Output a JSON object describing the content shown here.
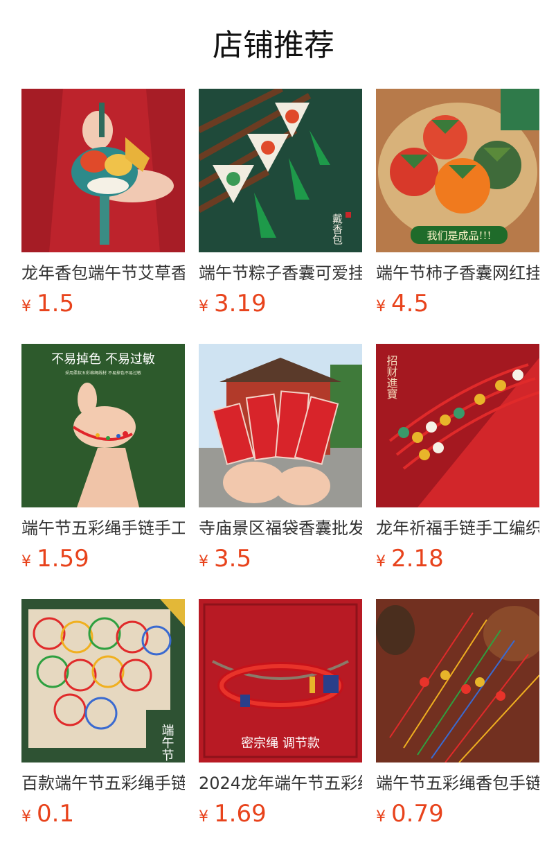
{
  "page": {
    "title": "店铺推荐"
  },
  "products": [
    {
      "name": "龙年香包端午节艾草香囊",
      "currency": "¥",
      "price": "1.5"
    },
    {
      "name": "端午节粽子香囊可爱挂件",
      "currency": "¥",
      "price": "3.19"
    },
    {
      "name": "端午节柿子香囊网红挂件",
      "currency": "¥",
      "price": "4.5"
    },
    {
      "name": "端午节五彩绳手链手工编织",
      "currency": "¥",
      "price": "1.59"
    },
    {
      "name": "寺庙景区福袋香囊批发",
      "currency": "¥",
      "price": "3.5"
    },
    {
      "name": "龙年祈福手链手工编织红绳",
      "currency": "¥",
      "price": "2.18"
    },
    {
      "name": "百款端午节五彩绳手链",
      "currency": "¥",
      "price": "0.1"
    },
    {
      "name": "2024龙年端午节五彩绳",
      "currency": "¥",
      "price": "1.69"
    },
    {
      "name": "端午节五彩绳香包手链",
      "currency": "¥",
      "price": "0.79"
    }
  ],
  "image_text": {
    "p2": "戴香包",
    "p3": "我们是成品!!!",
    "p4_main": "不易掉色 不易过敏",
    "p4_sub": "采用柔软五彩棉绳线材 不易掉色不易过敏",
    "p6": "招财進寶",
    "p7": "端午节",
    "p8": "密宗绳 调节款"
  }
}
